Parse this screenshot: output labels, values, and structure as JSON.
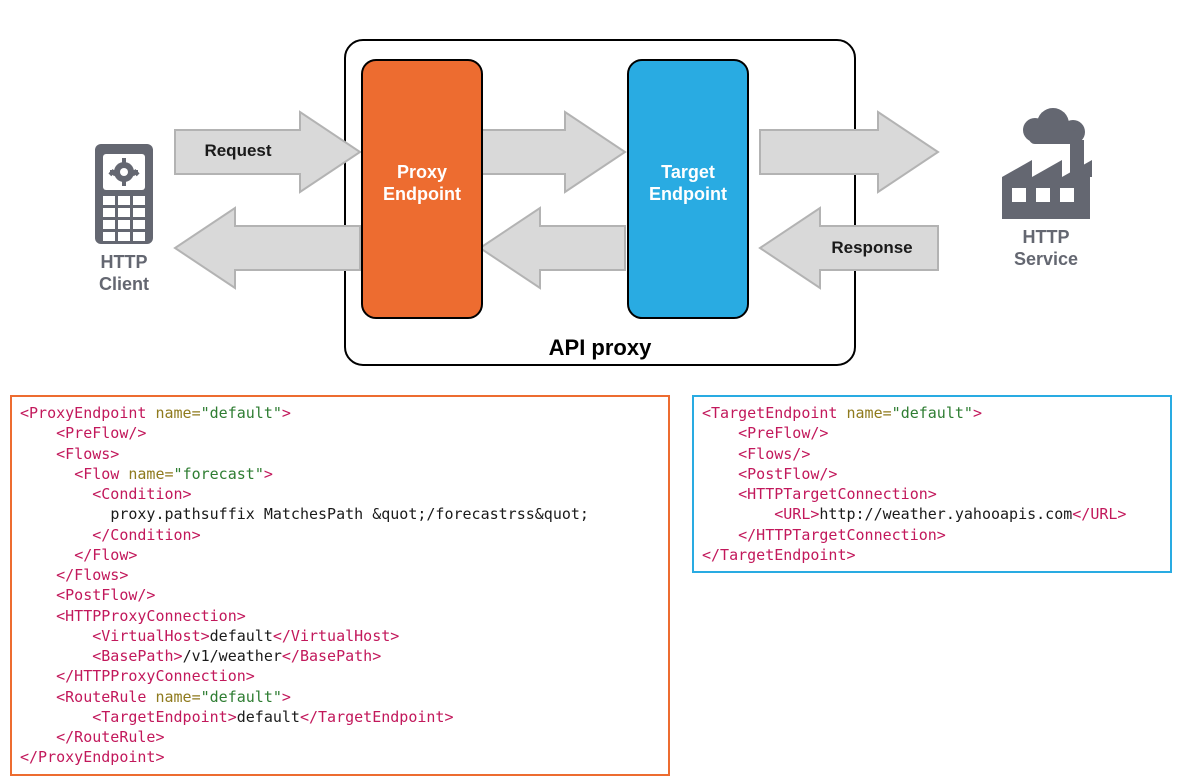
{
  "diagram": {
    "client_label": "HTTP",
    "client_label2": "Client",
    "service_label": "HTTP",
    "service_label2": "Service",
    "request_label": "Request",
    "response_label": "Response",
    "proxy_endpoint_label1": "Proxy",
    "proxy_endpoint_label2": "Endpoint",
    "target_endpoint_label1": "Target",
    "target_endpoint_label2": "Endpoint",
    "api_proxy_label": "API proxy",
    "colors": {
      "proxy_box": "#ed6c30",
      "target_box": "#29abe2",
      "arrow_fill": "#d9d9d9",
      "arrow_stroke": "#b3b3b3",
      "icon": "#646771",
      "container": "#000000"
    }
  },
  "proxy_code": {
    "title": "ProxyEndpoint",
    "name_attr": "default",
    "flow_name": "forecast",
    "condition_text": "proxy.pathsuffix MatchesPath &quot;/forecastrss&quot;",
    "virtual_host": "default",
    "base_path": "/v1/weather",
    "route_rule_name": "default",
    "target_endpoint": "default"
  },
  "target_code": {
    "title": "TargetEndpoint",
    "name_attr": "default",
    "url": "http://weather.yahooapis.com"
  }
}
